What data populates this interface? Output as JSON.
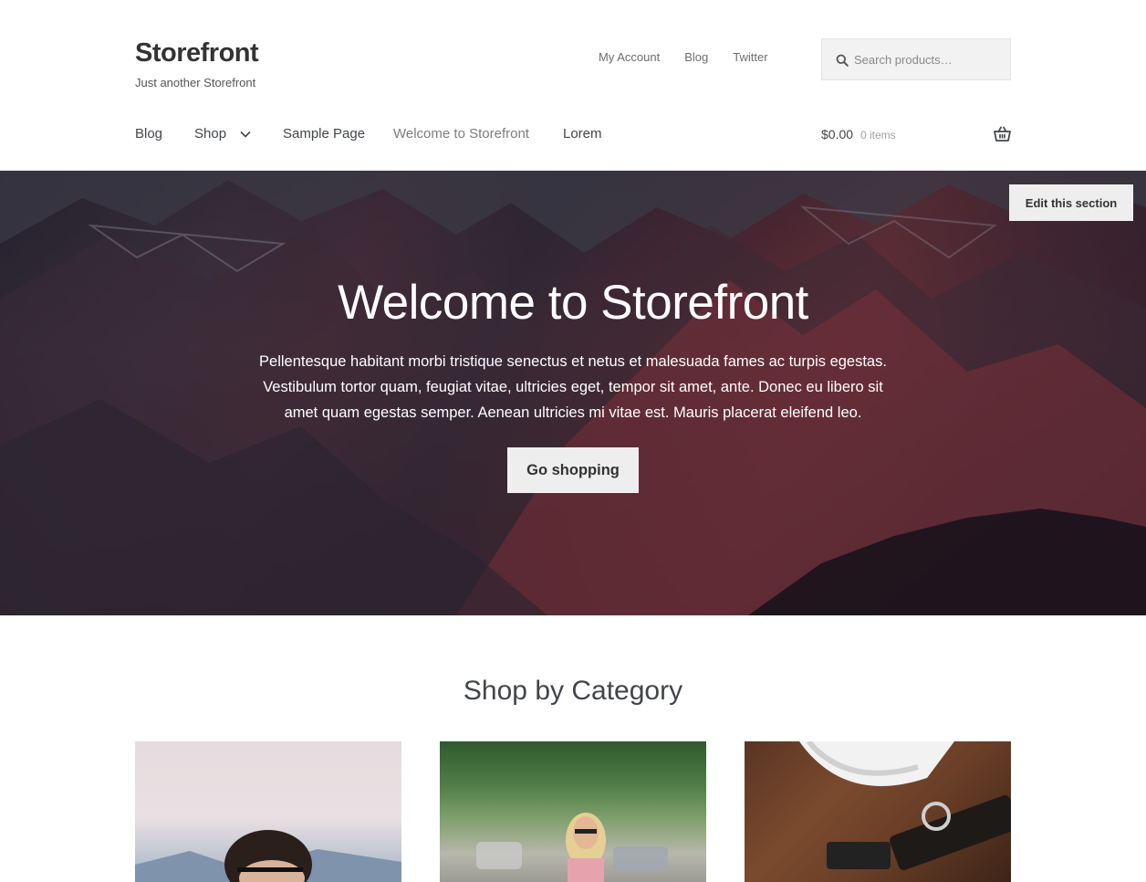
{
  "header": {
    "site_title": "Storefront",
    "tagline": "Just another Storefront",
    "secondary_nav": [
      "My Account",
      "Blog",
      "Twitter"
    ],
    "search": {
      "placeholder": "Search products…",
      "icon": "search-icon"
    },
    "primary_nav": [
      {
        "label": "Blog"
      },
      {
        "label": "Shop",
        "has_submenu": true
      },
      {
        "label": "Sample Page"
      },
      {
        "label": "Welcome to Storefront",
        "current": true
      },
      {
        "label": "Lorem"
      }
    ],
    "cart": {
      "amount": "$0.00",
      "items": "0 items",
      "icon": "basket-icon"
    }
  },
  "hero": {
    "title": "Welcome to Storefront",
    "text": "Pellentesque habitant morbi tristique senectus et netus et malesuada fames ac turpis egestas. Vestibulum tortor quam, feugiat vitae, ultricies eget, tempor sit amet, ante. Donec eu libero sit amet quam egestas semper. Aenean ultricies mi vitae est. Mauris placerat eleifend leo.",
    "button": "Go shopping",
    "edit_button": "Edit this section"
  },
  "categories": {
    "title": "Shop by Category"
  },
  "colors": {
    "text": "#43454b",
    "button_bg": "#eeeeee",
    "search_bg": "#f2f2f2"
  }
}
